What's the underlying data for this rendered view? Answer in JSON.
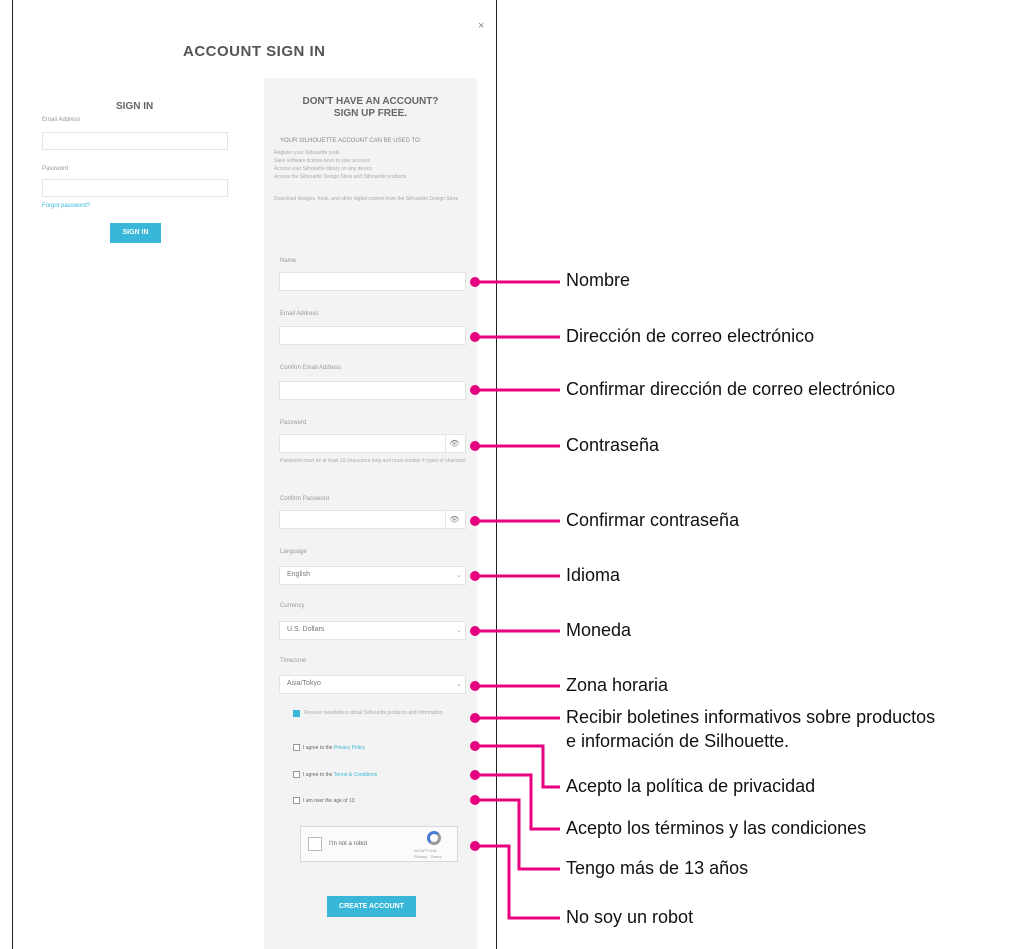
{
  "modal": {
    "title": "ACCOUNT SIGN IN",
    "close": "×"
  },
  "signin": {
    "heading": "SIGN IN",
    "email_label": "Email Address",
    "password_label": "Password",
    "forgot": "Forgot password?",
    "button": "SIGN IN"
  },
  "signup": {
    "heading1": "DON'T HAVE AN ACCOUNT?",
    "heading2": "SIGN UP FREE.",
    "subheading": "YOUR SILHOUETTE ACCOUNT CAN BE USED TO:",
    "bullets": [
      "Register your Silhouette tools",
      "Save software license keys to your account",
      "Access your Silhouette library on any device",
      "Access the Silhouette Design Store and Silhouette products",
      "Download designs, fonts, and other digital content from the Silhouette Design Store"
    ],
    "name_label": "Name",
    "email_label": "Email Address",
    "confirm_email_label": "Confirm Email Address",
    "password_label": "Password",
    "password_hint": "Password must be at least 10 characters long and must contain 4 types of character",
    "confirm_password_label": "Confirm Password",
    "language_label": "Language",
    "language_value": "English",
    "currency_label": "Currency",
    "currency_value": "U.S. Dollars",
    "timezone_label": "Timezone",
    "timezone_value": "Asia/Tokyo",
    "newsletter_text": "Receive newsletters about Silhouette products and information",
    "privacy_prefix": "I agree to the ",
    "privacy_link": "Privacy Policy",
    "terms_prefix": "I agree to the ",
    "terms_link": "Terms & Conditions",
    "age_text": "I am over the age of 13",
    "captcha_text": "I'm not a robot",
    "captcha_brand": "reCAPTCHA",
    "captcha_links": "Privacy - Terms",
    "create_button": "CREATE ACCOUNT"
  },
  "annotations": [
    "Nombre",
    "Dirección de correo electrónico",
    "Confirmar dirección de correo electrónico",
    "Contraseña",
    "Confirmar contraseña",
    "Idioma",
    "Moneda",
    "Zona horaria",
    "Recibir boletines informativos sobre productos",
    "e información de Silhouette.",
    "Acepto la política de privacidad",
    "Acepto los términos y las condiciones",
    "Tengo más de 13 años",
    "No soy un robot"
  ],
  "colors": {
    "accent": "#39b7d8",
    "callout": "#e6007e"
  },
  "icons": {
    "eye": "eye-off-icon",
    "chevron": "chevron-down-icon",
    "recaptcha": "recaptcha-icon"
  }
}
